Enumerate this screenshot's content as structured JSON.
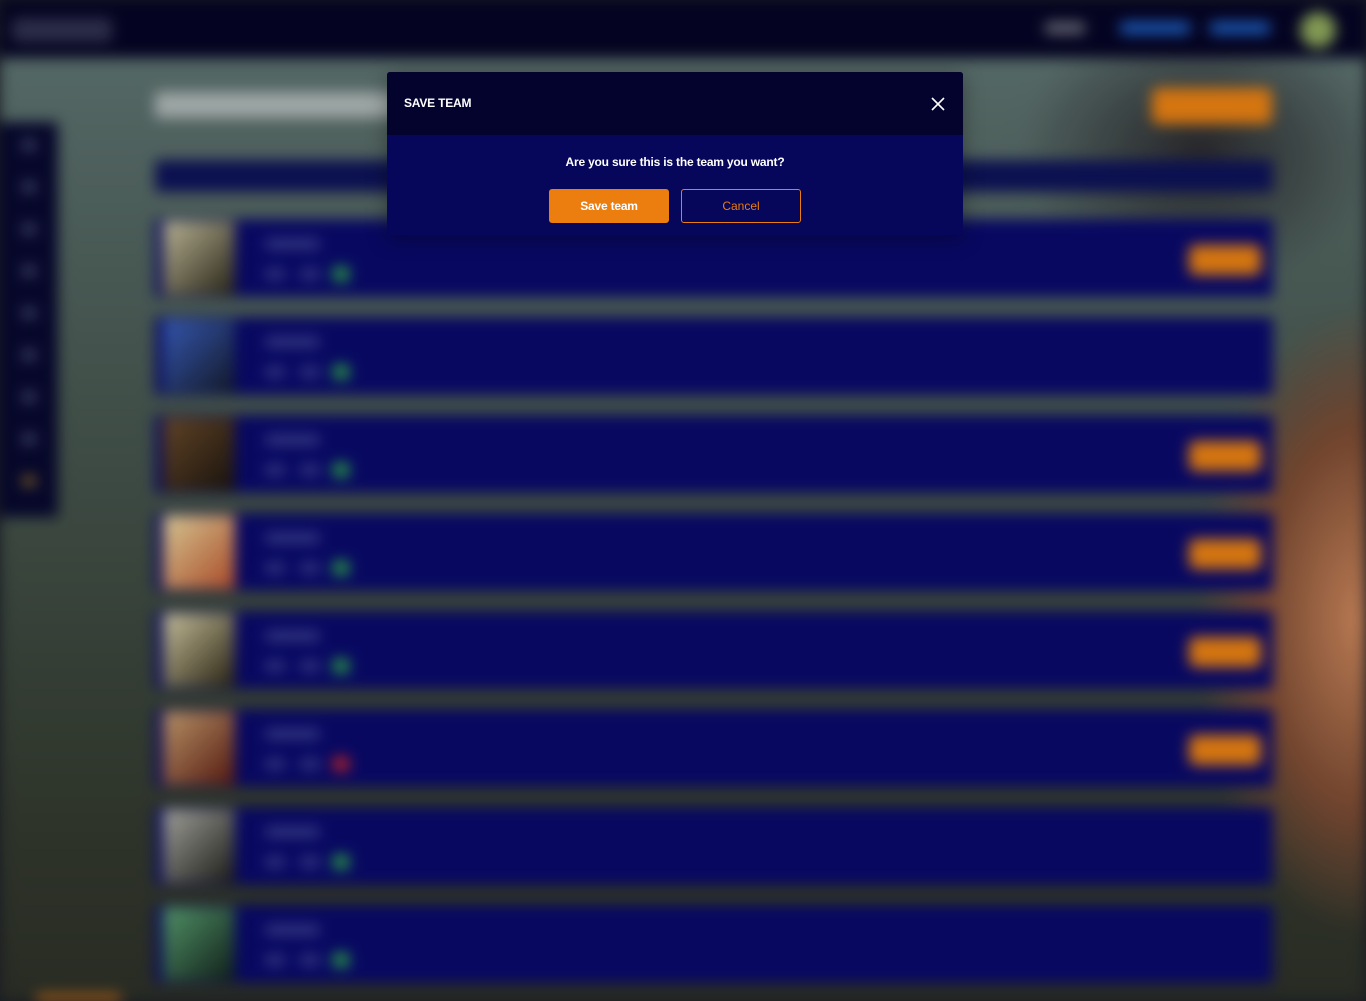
{
  "modal": {
    "title": "SAVE TEAM",
    "question": "Are you sure this is the team you want?",
    "save_label": "Save team",
    "cancel_label": "Cancel",
    "close_icon": "close-icon"
  },
  "background": {
    "rows": [
      {
        "flag": "green",
        "has_pick": true
      },
      {
        "flag": "green",
        "has_pick": false
      },
      {
        "flag": "green",
        "has_pick": true
      },
      {
        "flag": "green",
        "has_pick": true
      },
      {
        "flag": "green",
        "has_pick": true
      },
      {
        "flag": "red",
        "has_pick": true
      },
      {
        "flag": "green",
        "has_pick": false
      },
      {
        "flag": "green",
        "has_pick": false
      }
    ]
  },
  "colors": {
    "accent": "#ec7d0f",
    "modal_body": "#06065a",
    "modal_header": "#03032e",
    "row_bg": "#09096a",
    "topbar": "#050424"
  }
}
